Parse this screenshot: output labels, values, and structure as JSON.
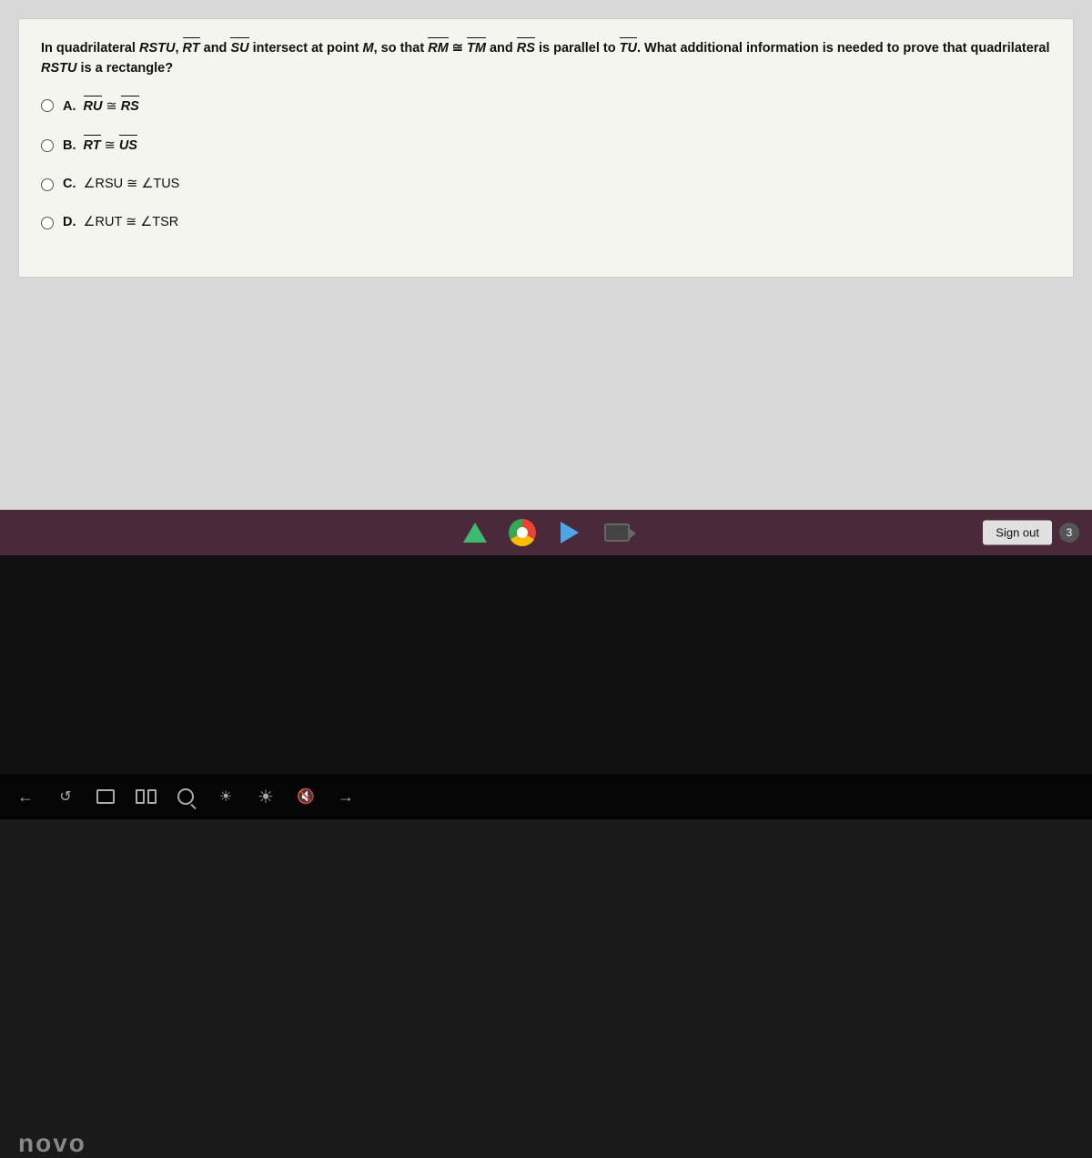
{
  "question": {
    "text": "In quadrilateral RSTU, RT and SU intersect at point M, so that RM ≅ TM and RS is parallel to TU. What additional information is needed to prove that quadrilateral RSTU is a rectangle?",
    "options": [
      {
        "id": "A",
        "text_parts": [
          "RU",
          "≅",
          "RS"
        ]
      },
      {
        "id": "B",
        "text_parts": [
          "RT",
          "≅",
          "US"
        ]
      },
      {
        "id": "C",
        "text_parts": [
          "∠RSU",
          "≅",
          "∠TUS"
        ]
      },
      {
        "id": "D",
        "text_parts": [
          "∠RUT",
          "≅",
          "∠TSR"
        ]
      }
    ]
  },
  "taskbar": {
    "icons": [
      "triangle",
      "chrome",
      "play",
      "camera"
    ]
  },
  "sign_out_label": "Sign out",
  "notification_count": "3",
  "lenovo_logo": "novo",
  "bottom_shelf": {
    "icons": [
      "back",
      "refresh",
      "window",
      "multiwindow",
      "search",
      "brightness",
      "volume",
      "mute",
      "forward"
    ]
  },
  "colors": {
    "taskbar_bg": "#4a2a3a",
    "screen_bg": "#d8d8d8",
    "card_bg": "#f5f5f0",
    "sign_out_bg": "#e0e0e0"
  }
}
